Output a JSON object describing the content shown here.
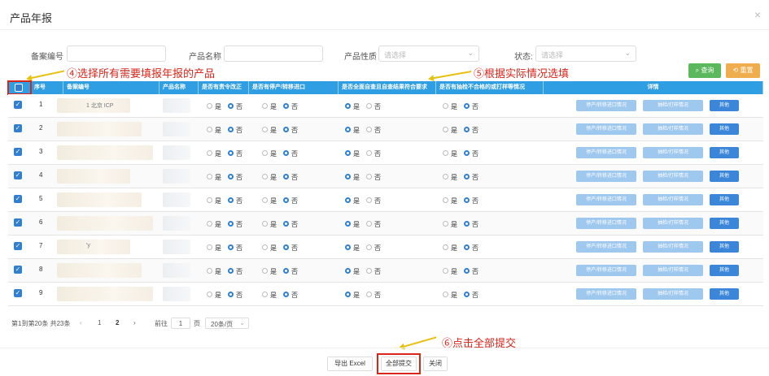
{
  "dialog": {
    "title": "产品年报",
    "close_glyph": "×"
  },
  "filters": {
    "record_no_label": "备案编号",
    "product_name_label": "产品名称",
    "product_nature_label": "产品性质",
    "product_nature_placeholder": "请选择",
    "status_label": "状态:",
    "status_placeholder": "请选择",
    "query_button": "⌕ 查询",
    "reset_button": "⟲ 重置"
  },
  "annotations": {
    "a4": "④选择所有需要填报年报的产品",
    "a5": "⑤根据实际情况选填",
    "a6": "⑥点击全部提交"
  },
  "table": {
    "headers": [
      "序号",
      "备案编号",
      "产品名称",
      "是否有责令改正",
      "是否有停产/转移进口",
      "是否全面自查且自查结果符合要求",
      "是否有抽检不合格的或打样等情况",
      "详情"
    ],
    "rows": [
      {
        "index": "1",
        "code_hint": "1 北京 ICP",
        "checked": true
      },
      {
        "index": "2",
        "checked": true
      },
      {
        "index": "3",
        "checked": true
      },
      {
        "index": "4",
        "checked": true
      },
      {
        "index": "5",
        "checked": true
      },
      {
        "index": "6",
        "checked": true
      },
      {
        "index": "7",
        "code_hint": "'y",
        "checked": true
      },
      {
        "index": "8",
        "checked": true
      },
      {
        "index": "9",
        "checked": true
      }
    ],
    "yes": "是",
    "no": "否",
    "check_glyph": "✓",
    "detail_buttons": [
      "停产/转移进口情况",
      "抽检/打样情况",
      "其他"
    ]
  },
  "pagination": {
    "summary": "第1到第20条 共23条",
    "prev": "‹",
    "pages": [
      "1",
      "2"
    ],
    "current": "2",
    "next": "›",
    "goto_label": "前往",
    "goto_value": "1",
    "page_unit": "页",
    "page_size": "20条/页",
    "page_size_arrow": "⌄"
  },
  "footer": {
    "export": "导出 Excel",
    "submit_all": "全部提交",
    "close": "关闭"
  },
  "colors": {
    "header_blue": "#2f9ee3",
    "annotation_red": "#d9251a",
    "arrow_yellow": "#e8c010",
    "query_green": "#5cb85c",
    "reset_orange": "#f0ad4e"
  }
}
